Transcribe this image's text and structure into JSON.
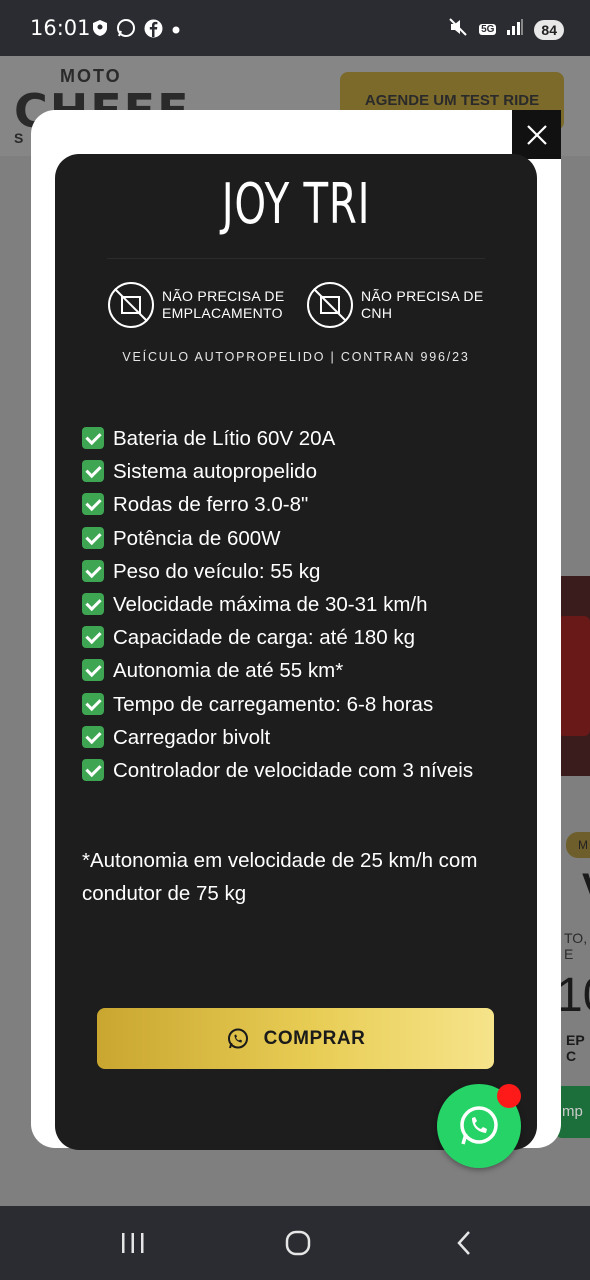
{
  "status_bar": {
    "time": "16:01",
    "battery": "84",
    "network": "5G"
  },
  "background_page": {
    "logo_top": "MOTO",
    "logo_main": "CHEFF",
    "logo_bottom_letter": "S",
    "test_ride_button": "AGENDE UM TEST RIDE",
    "badge_fragment": "M",
    "title_fragment": "V",
    "subtitle_fragment": "TO, E",
    "price_fragment": "10",
    "cep_fragment": "EP C",
    "green_button_fragment": "mp"
  },
  "modal": {
    "title": "JOY TRI",
    "features": [
      {
        "line1": "NÃO PRECISA DE",
        "line2": "EMPLACAMENTO",
        "icon": "no-plate-icon"
      },
      {
        "line1": "NÃO PRECISA DE",
        "line2": "CNH",
        "icon": "no-license-icon"
      }
    ],
    "subtitle": "VEÍCULO AUTOPROPELIDO | CONTRAN 996/23",
    "specs": [
      "Bateria de Lítio 60V 20A",
      "Sistema autopropelido",
      "Rodas de ferro 3.0-8\"",
      "Potência de 600W",
      "Peso do veículo: 55 kg",
      "Velocidade máxima de 30-31 km/h",
      "Capacidade de carga: até 180 kg",
      "Autonomia de até 55 km*",
      "Tempo de carregamento: 6-8 horas",
      "Carregador bivolt",
      "Controlador de velocidade com 3 níveis"
    ],
    "note": "*Autonomia em velocidade de 25 km/h com condutor de 75 kg",
    "buy_button": "COMPRAR"
  },
  "colors": {
    "card_bg": "#1d1d1e",
    "check_green": "#3ea552",
    "button_gold": "#d9b940",
    "whatsapp_green": "#26d366",
    "notification_red": "#ff1a1a"
  }
}
